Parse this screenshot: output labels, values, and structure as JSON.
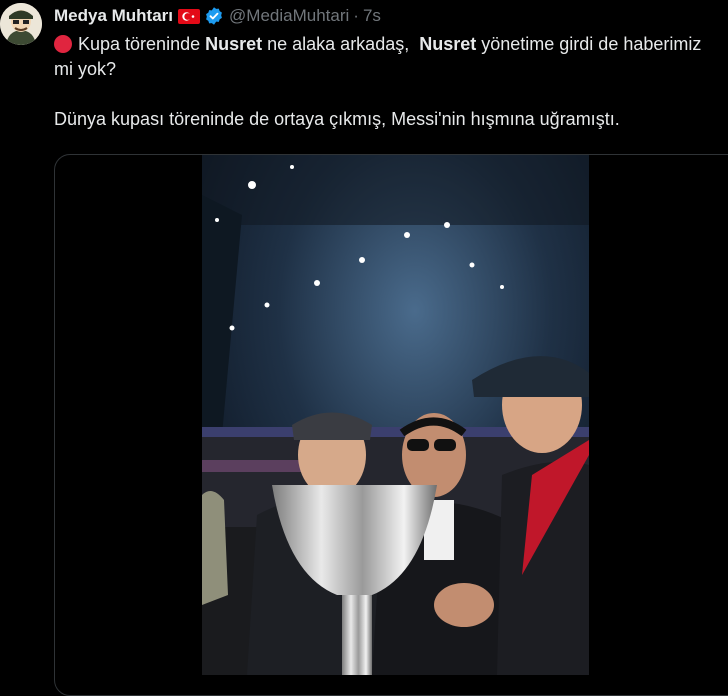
{
  "author": {
    "display_name": "Medya Muhtarı",
    "handle": "@MediaMuhtari",
    "separator": "·",
    "time": "7s",
    "flag_icon": "turkey-flag-icon",
    "verified_icon": "verified-badge-icon"
  },
  "tweet": {
    "line1_pre": "Kupa töreninde ",
    "line1_bold1": "Nusret",
    "line1_mid": " ne alaka arkadaş,  ",
    "line1_bold2": "Nusret",
    "line1_post": " yönetime girdi de haberimiz mi yok?",
    "line2": "Dünya kupası töreninde de ortaya çıkmış, Messi'nin hışmına uğramıştı."
  },
  "colors": {
    "background": "#000000",
    "text": "#e7e9ea",
    "muted": "#71767b",
    "verified": "#1d9bf0",
    "red_circle": "#e0253f"
  }
}
